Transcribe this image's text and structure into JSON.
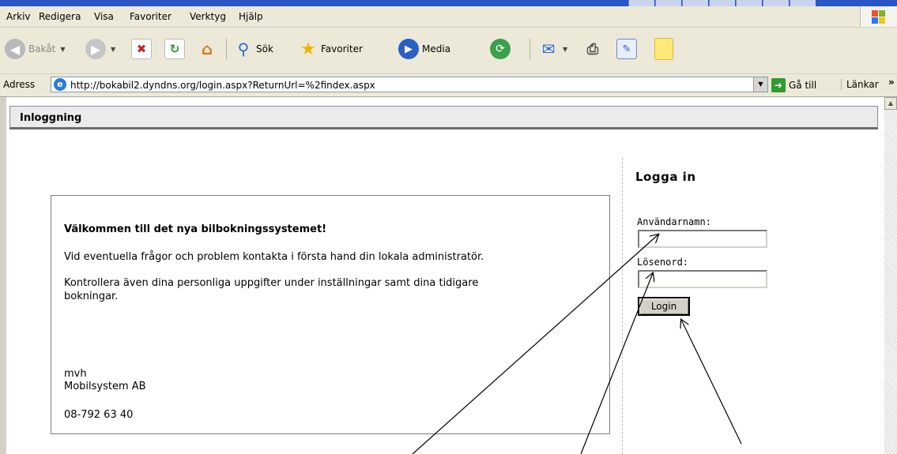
{
  "menu": {
    "items": [
      "Arkiv",
      "Redigera",
      "Visa",
      "Favoriter",
      "Verktyg",
      "Hjälp"
    ]
  },
  "toolbar": {
    "back_label": "Bakåt",
    "search_label": "Sök",
    "favorites_label": "Favoriter",
    "media_label": "Media"
  },
  "addressbar": {
    "label": "Adress",
    "url": "http://bokabil2.dyndns.org/login.aspx?ReturnUrl=%2findex.aspx",
    "go_label": "Gå till",
    "links_label": "Länkar",
    "links_chevron": "»"
  },
  "page": {
    "header_title": "Inloggning"
  },
  "welcome": {
    "title": "Välkommen till det nya bilbokningssystemet!",
    "line1": "Vid eventuella frågor och problem kontakta i första hand din lokala administratör.",
    "line2a": "Kontrollera även dina personliga uppgifter under inställningar samt dina tidigare",
    "line2b": "bokningar.",
    "signoff": "mvh",
    "company": "Mobilsystem AB",
    "phone": "08-792 63 40"
  },
  "login": {
    "heading": "Logga in",
    "username_label": "Användarnamn:",
    "username_value": "",
    "password_label": "Lösenord:",
    "password_value": "",
    "button_label": "Login"
  },
  "colors": {
    "chrome": "#ece9d8",
    "title_blue": "#2a55c4",
    "header_strip": "#ebebeb",
    "go_green": "#2f9a2f"
  },
  "icons": [
    "back-icon",
    "forward-icon",
    "stop-icon",
    "refresh-icon",
    "home-icon",
    "search-icon",
    "favorites-star-icon",
    "media-icon",
    "history-icon",
    "mail-icon",
    "print-icon",
    "edit-icon",
    "note-icon",
    "ie-page-icon",
    "go-arrow-icon",
    "windows-logo-icon"
  ]
}
